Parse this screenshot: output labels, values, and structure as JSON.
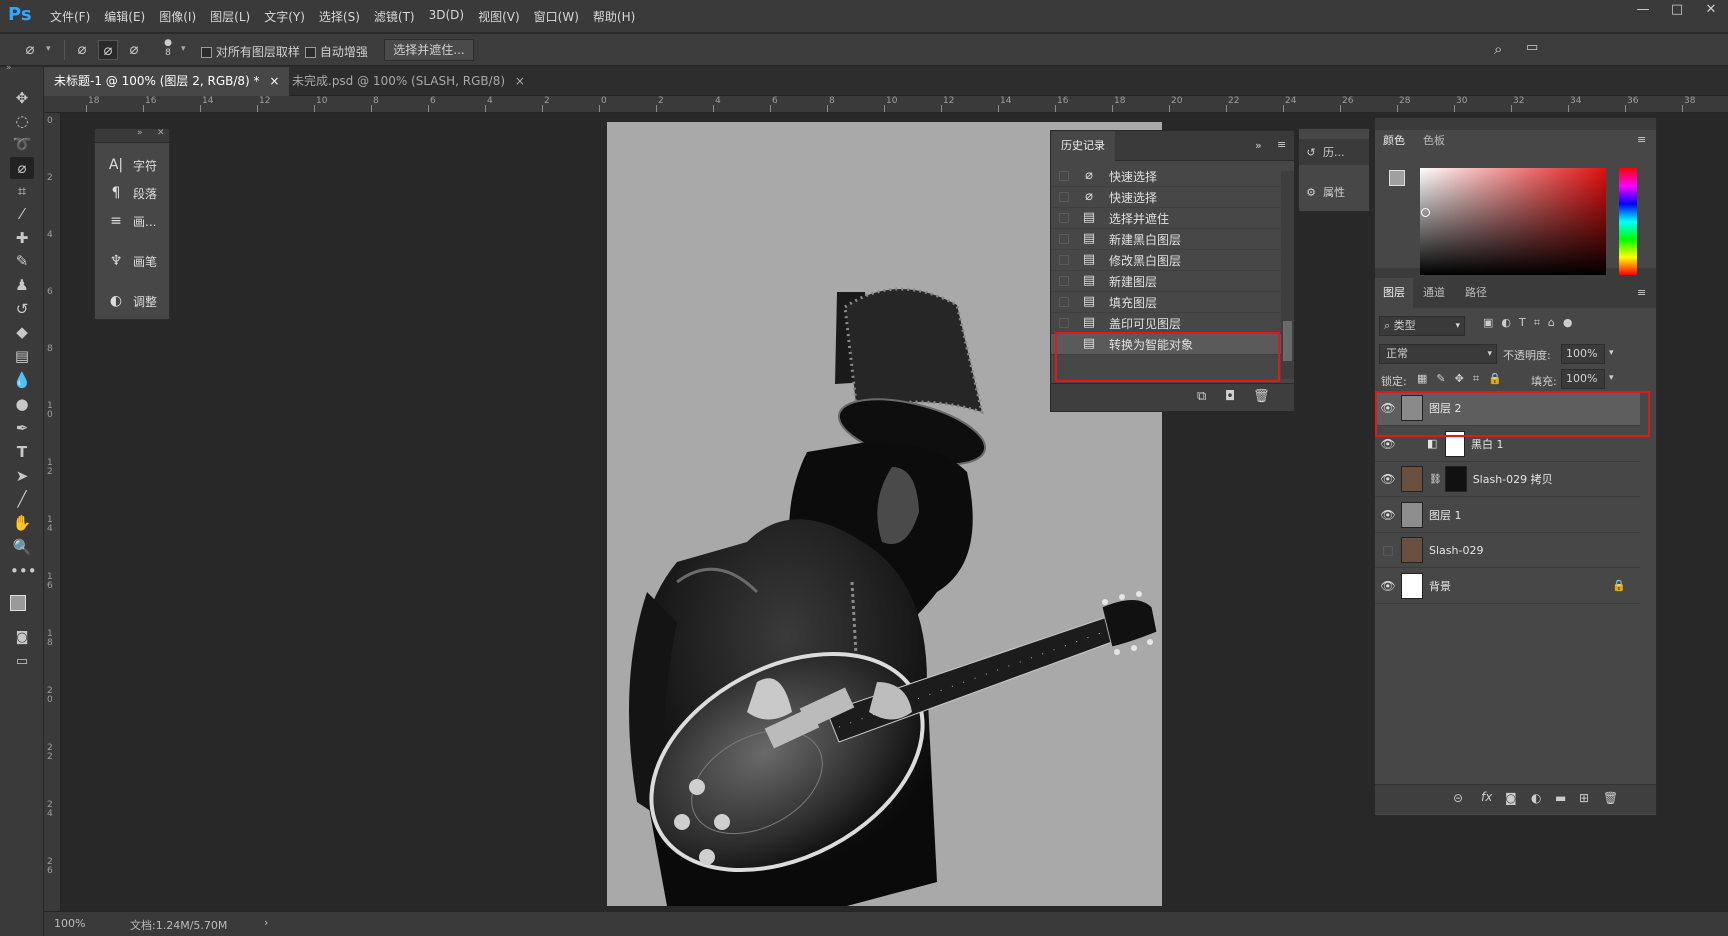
{
  "app": {
    "logo": "Ps"
  },
  "menu": [
    "文件(F)",
    "编辑(E)",
    "图像(I)",
    "图层(L)",
    "文字(Y)",
    "选择(S)",
    "滤镜(T)",
    "3D(D)",
    "视图(V)",
    "窗口(W)",
    "帮助(H)"
  ],
  "window_controls": [
    "—",
    "□",
    "✕"
  ],
  "options": {
    "brush_size": "8",
    "sample_all_label": "对所有图层取样",
    "auto_enhance_label": "自动增强",
    "select_mask_button": "选择并遮住..."
  },
  "tabs": [
    {
      "label": "未标题-1 @ 100% (图层 2, RGB/8) *",
      "close": "×",
      "active": true
    },
    {
      "label": "未完成.psd @ 100% (SLASH, RGB/8)",
      "close": "×",
      "active": false
    }
  ],
  "ruler_h": [
    "18",
    "16",
    "14",
    "12",
    "10",
    "8",
    "6",
    "4",
    "2",
    "0",
    "2",
    "4",
    "6",
    "8",
    "10",
    "12",
    "14",
    "16",
    "18",
    "20",
    "22",
    "24",
    "26",
    "28",
    "30",
    "32",
    "34",
    "36",
    "38"
  ],
  "ruler_v": [
    "0",
    "2",
    "4",
    "6",
    "8",
    "1 0",
    "1 2",
    "1 4",
    "1 6",
    "1 8",
    "2 0",
    "2 2",
    "2 4",
    "2 6"
  ],
  "mini_panel": [
    {
      "icon": "character-icon",
      "glyph": "A|",
      "label": "字符"
    },
    {
      "icon": "paragraph-icon",
      "glyph": "¶",
      "label": "段落"
    },
    {
      "icon": "sliders-icon",
      "glyph": "≡",
      "label": "画..."
    },
    {
      "icon": "brush-icon",
      "glyph": "♆",
      "label": "画笔"
    },
    {
      "icon": "adjustments-icon",
      "glyph": "◐",
      "label": "调整"
    }
  ],
  "history": {
    "tab": "历史记录",
    "items": [
      "快速选择",
      "快速选择",
      "选择并遮住",
      "新建黑白图层",
      "修改黑白图层",
      "新建图层",
      "填充图层",
      "盖印可见图层",
      "转换为智能对象"
    ],
    "highlighted": [
      "盖印可见图层",
      "转换为智能对象"
    ]
  },
  "side_dock": [
    {
      "icon": "history-icon",
      "label": "历..."
    },
    {
      "icon": "properties-icon",
      "label": "属性"
    }
  ],
  "color_panel": {
    "tabs": [
      "颜色",
      "色板"
    ],
    "fg": "#a0a0a0",
    "bg": "#000000"
  },
  "layers_panel": {
    "tabs": [
      "图层",
      "通道",
      "路径"
    ],
    "filter_kind": "类型",
    "blend_mode": "正常",
    "opacity_label": "不透明度:",
    "opacity": "100%",
    "lock_label": "锁定:",
    "fill_label": "填充:",
    "fill": "100%",
    "layers": [
      {
        "name": "图层 2",
        "visible": true,
        "selected": true
      },
      {
        "name": "黑白 1",
        "visible": true,
        "selected": false
      },
      {
        "name": "Slash-029 拷贝",
        "visible": true,
        "selected": false
      },
      {
        "name": "图层 1",
        "visible": true,
        "selected": false
      },
      {
        "name": "Slash-029",
        "visible": false,
        "selected": false
      },
      {
        "name": "背景",
        "visible": true,
        "selected": false
      }
    ],
    "footer_icons": [
      "link-icon",
      "fx-icon",
      "mask-icon",
      "adjustment-layer-icon",
      "folder-icon",
      "new-layer-icon",
      "trash-icon"
    ]
  },
  "status": {
    "zoom": "100%",
    "doc_info": "文档:1.24M/5.70M"
  }
}
